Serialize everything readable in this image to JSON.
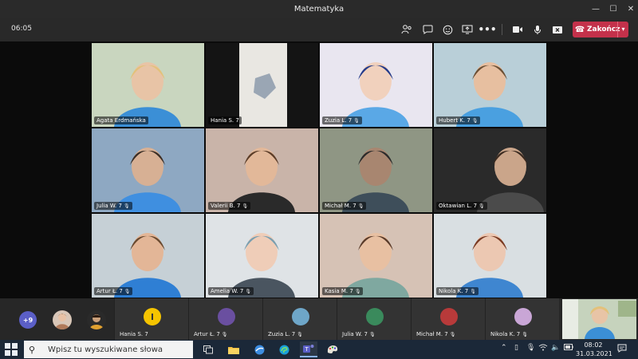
{
  "window": {
    "title": "Matematyka",
    "controls": {
      "minimize": "—",
      "maximize": "☐",
      "close": "✕"
    }
  },
  "meeting": {
    "timer": "06:05",
    "hangup_label": "Zakończ",
    "icons": [
      "people-icon",
      "chat-icon",
      "reactions-icon",
      "share-icon",
      "more-icon",
      "camera-icon",
      "mic-icon",
      "share-tray-icon"
    ]
  },
  "tiles": [
    {
      "name": "Agata Erdmańska",
      "muted": false,
      "bg": "#c9d6bf",
      "head": "#e8c4a6",
      "hair": "#e3c17a",
      "shirt": "#3b8fd6"
    },
    {
      "name": "Hania S. 7",
      "muted": false,
      "bg": "#141414",
      "head": "#000000",
      "hair": "#000000",
      "shirt": "#000000"
    },
    {
      "name": "Zuzia L. 7",
      "muted": true,
      "bg": "#e9e6f0",
      "head": "#f1d1bd",
      "hair": "#233a8a",
      "shirt": "#5aa8e6"
    },
    {
      "name": "Hubert K. 7",
      "muted": true,
      "bg": "#b9cfd8",
      "head": "#e7bfa0",
      "hair": "#6b4f34",
      "shirt": "#4aa0e0"
    },
    {
      "name": "Julia W. 7",
      "muted": true,
      "bg": "#8ea8c2",
      "head": "#d7b094",
      "hair": "#3a2e26",
      "shirt": "#3f8fe0"
    },
    {
      "name": "Valerii B. 7",
      "muted": true,
      "bg": "#c9b4a9",
      "head": "#e2b899",
      "hair": "#5b3d28",
      "shirt": "#2a2a2a"
    },
    {
      "name": "Michał M. 7",
      "muted": true,
      "bg": "#8f9684",
      "head": "#a88670",
      "hair": "#2b2b2b",
      "shirt": "#3e4e5a"
    },
    {
      "name": "Oktawian L. 7",
      "muted": true,
      "bg": "#2a2a2a",
      "head": "#caa58a",
      "hair": "#3a2a20",
      "shirt": "#4b4b4b"
    },
    {
      "name": "Artur Ł. 7",
      "muted": true,
      "bg": "#c6d0d6",
      "head": "#e3b697",
      "hair": "#6a4a30",
      "shirt": "#2f7fd4"
    },
    {
      "name": "Amelia W. 7",
      "muted": true,
      "bg": "#dfe3e6",
      "head": "#efcdb8",
      "hair": "#7a9fb0",
      "shirt": "#4a5560"
    },
    {
      "name": "Kasia M. 7",
      "muted": true,
      "bg": "#d6c2b5",
      "head": "#e8c0a2",
      "hair": "#5a3b2a",
      "shirt": "#7fa8a0"
    },
    {
      "name": "Nikola K. 7",
      "muted": true,
      "bg": "#d9dfe2",
      "head": "#ecc8b2",
      "hair": "#7a3a22",
      "shirt": "#3f86d0"
    }
  ],
  "strip": {
    "overflow_count": "+9",
    "cards": [
      {
        "name": "Hania S. 7",
        "muted": false,
        "color": "#f5c400"
      },
      {
        "name": "Artur Ł. 7",
        "muted": true,
        "color": "#6a4fa0"
      },
      {
        "name": "Zuzia L. 7",
        "muted": true,
        "color": "#6ea6c8"
      },
      {
        "name": "Julia W. 7",
        "muted": true,
        "color": "#3a8a5c"
      },
      {
        "name": "Michał M. 7",
        "muted": true,
        "color": "#b83a3a"
      },
      {
        "name": "Nikola K. 7",
        "muted": true,
        "color": "#c9a6d6"
      }
    ]
  },
  "taskbar": {
    "search_placeholder": "Wpisz tu wyszukiwane słowa",
    "time": "08:02",
    "date": "31.03.2021"
  }
}
